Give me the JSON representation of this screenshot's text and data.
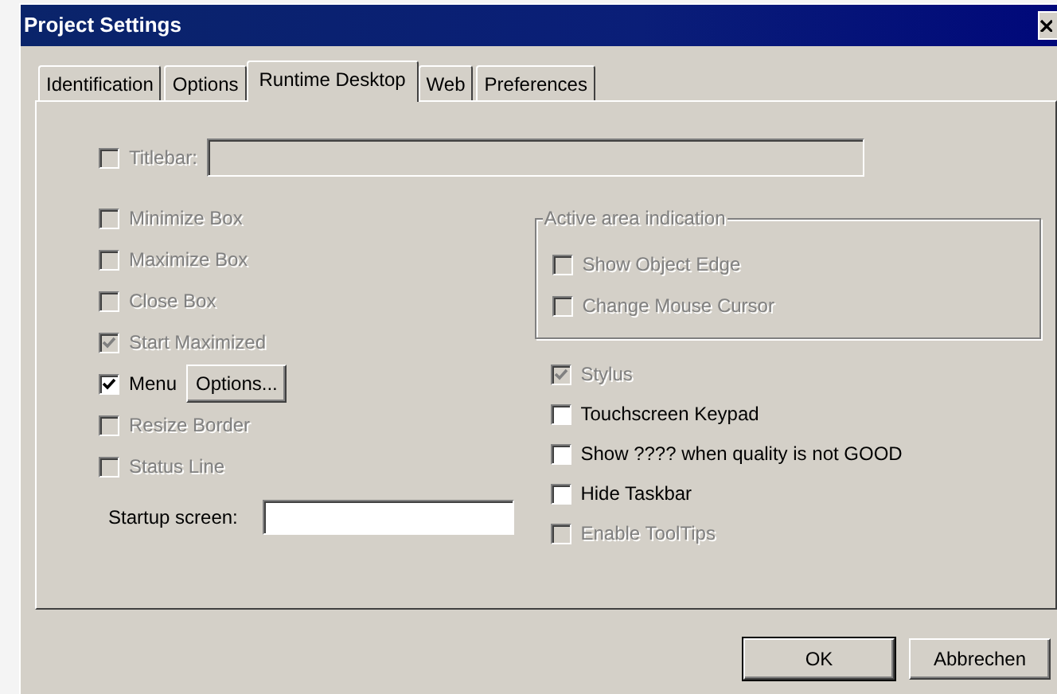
{
  "window": {
    "title": "Project Settings"
  },
  "tabs": [
    {
      "label": "Identification",
      "selected": false
    },
    {
      "label": "Options",
      "selected": false
    },
    {
      "label": "Runtime Desktop",
      "selected": true
    },
    {
      "label": "Web",
      "selected": false
    },
    {
      "label": "Preferences",
      "selected": false
    }
  ],
  "titlebar": {
    "label": "Titlebar:",
    "checked": false,
    "disabled": true
  },
  "left_options": [
    {
      "label": "Minimize Box",
      "checked": false,
      "disabled": true
    },
    {
      "label": "Maximize Box",
      "checked": false,
      "disabled": true
    },
    {
      "label": "Close Box",
      "checked": false,
      "disabled": true
    },
    {
      "label": "Start Maximized",
      "checked": true,
      "disabled": true
    },
    {
      "label": "Menu",
      "checked": true,
      "disabled": false,
      "button": "Options..."
    },
    {
      "label": "Resize Border",
      "checked": false,
      "disabled": true
    },
    {
      "label": "Status Line",
      "checked": false,
      "disabled": true
    }
  ],
  "startup_screen": {
    "label": "Startup screen:"
  },
  "active_area": {
    "title": "Active area indication",
    "disabled": true,
    "options": [
      {
        "label": "Show Object Edge",
        "checked": false,
        "disabled": true
      },
      {
        "label": "Change Mouse Cursor",
        "checked": false,
        "disabled": true
      }
    ]
  },
  "right_options": [
    {
      "label": "Stylus",
      "checked": true,
      "disabled": true
    },
    {
      "label": "Touchscreen Keypad",
      "checked": false,
      "disabled": false
    },
    {
      "label": "Show ???? when quality is not GOOD",
      "checked": false,
      "disabled": false
    },
    {
      "label": "Hide Taskbar",
      "checked": false,
      "disabled": false
    },
    {
      "label": "Enable ToolTips",
      "checked": false,
      "disabled": true
    }
  ],
  "buttons": [
    {
      "label": "OK",
      "default": true
    },
    {
      "label": "Abbrechen",
      "default": false
    }
  ]
}
